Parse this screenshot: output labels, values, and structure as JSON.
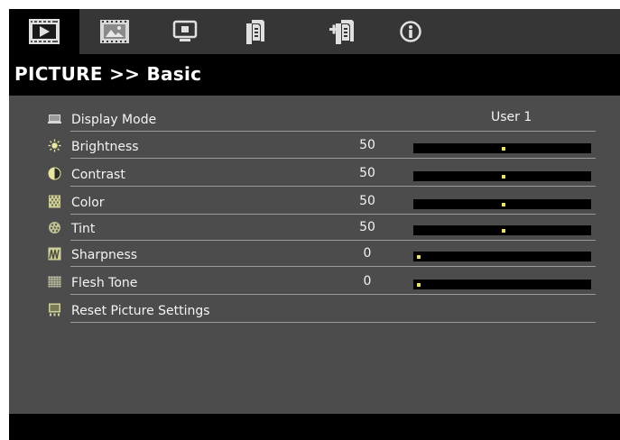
{
  "colors": {
    "panel": "#4c4c4c",
    "tabbar": "#363636",
    "band": "#000000",
    "text": "#f4f4f4",
    "knob": "#e8e46a",
    "separator": "#9a9a9a"
  },
  "tabs": [
    {
      "icon": "picture-play-icon",
      "active": true
    },
    {
      "icon": "image-frame-icon",
      "active": false
    },
    {
      "icon": "monitor-icon",
      "active": false
    },
    {
      "icon": "document-settings-icon",
      "active": false
    },
    {
      "icon": "document-add-icon",
      "active": false
    },
    {
      "icon": "info-icon",
      "active": false
    }
  ],
  "header": {
    "title": "PICTURE >> Basic"
  },
  "menu": {
    "display_mode": {
      "label": "Display Mode",
      "value": "User 1",
      "icon": "display-mode-icon"
    },
    "brightness": {
      "label": "Brightness",
      "value": "50",
      "level": 0.5,
      "icon": "brightness-icon"
    },
    "contrast": {
      "label": "Contrast",
      "value": "50",
      "level": 0.5,
      "icon": "contrast-icon"
    },
    "color": {
      "label": "Color",
      "value": "50",
      "level": 0.5,
      "icon": "color-icon"
    },
    "tint": {
      "label": "Tint",
      "value": "50",
      "level": 0.5,
      "icon": "tint-icon"
    },
    "sharpness": {
      "label": "Sharpness",
      "value": "0",
      "level": 0,
      "icon": "sharpness-icon"
    },
    "flesh_tone": {
      "label": "Flesh Tone",
      "value": "0",
      "level": 0,
      "icon": "flesh-tone-icon"
    },
    "reset": {
      "label": "Reset Picture Settings",
      "icon": "reset-icon"
    }
  }
}
